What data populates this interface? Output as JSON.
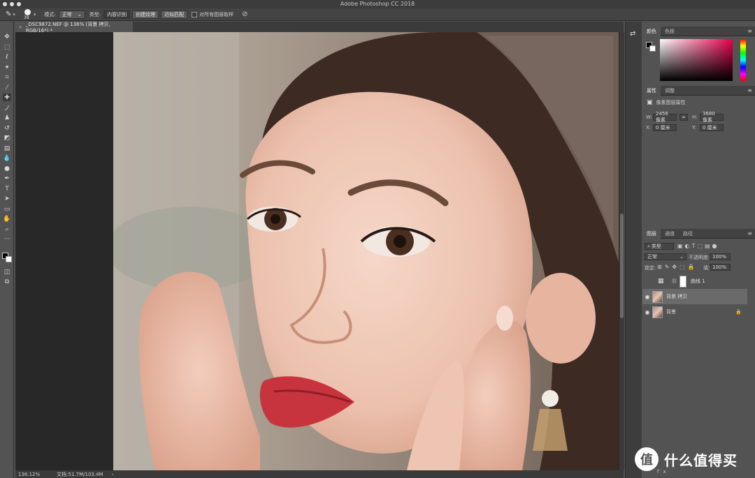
{
  "window": {
    "title": "Adobe Photoshop CC 2018"
  },
  "options": {
    "brush_size": "38",
    "mode_label": "模式:",
    "mode_value": "正常",
    "type_label": "类型:",
    "btn_content_aware": "内容识别",
    "btn_create_texture": "创建纹理",
    "btn_proximity": "近似匹配",
    "sample_all_label": "对所有图层取样"
  },
  "document": {
    "tab_title": "_DSC9872.NEF @ 136% (背景 拷贝, RGB/16*) *",
    "zoom": "136.12%",
    "doc_size": "文档:51.7M/103.4M"
  },
  "color_panel": {
    "tabs": [
      "颜色",
      "色板"
    ]
  },
  "properties_panel": {
    "tabs": [
      "属性",
      "调整"
    ],
    "header": "像素图层属性",
    "w_label": "W:",
    "w_value": "2456 像素",
    "h_label": "H:",
    "h_value": "3680 像素",
    "x_label": "X:",
    "x_value": "0 厘米",
    "y_label": "Y:",
    "y_value": "0 厘米"
  },
  "layers_panel": {
    "tabs": [
      "图层",
      "通道",
      "路径"
    ],
    "filter_kind": "类型",
    "blend_mode": "正常",
    "opacity_label": "不透明度:",
    "opacity_value": "100%",
    "lock_label": "锁定:",
    "fill_label": "填充:",
    "fill_value": "100%",
    "layers": [
      {
        "name": "曲线 1"
      },
      {
        "name": "背景 拷贝"
      },
      {
        "name": "背景"
      }
    ]
  },
  "watermark": {
    "text": "什么值得买",
    "logo": "值"
  },
  "colors": {
    "accent_red": "#e8004d",
    "panel_bg": "#535353"
  }
}
